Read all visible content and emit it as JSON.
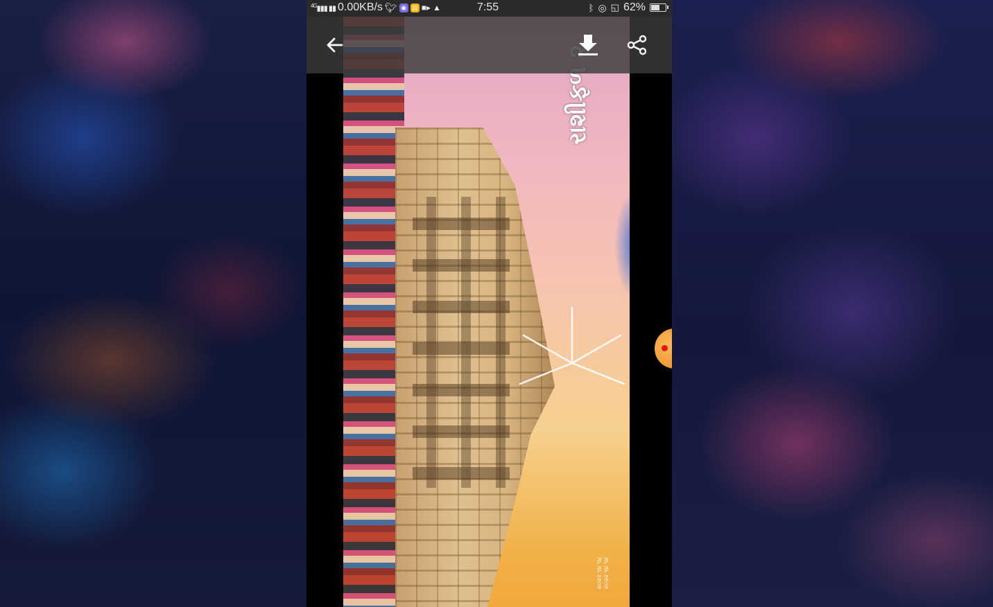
{
  "status_bar": {
    "network_type": "4G",
    "net_speed": "0.00KB/s",
    "time": "7:55",
    "battery_percent": "62%",
    "battery_level": 0.62,
    "icons": [
      "signal-icon",
      "twitter-icon",
      "app-icon",
      "notes-icon",
      "video-icon",
      "snapchat-icon",
      "bluetooth-icon",
      "eye-icon",
      "cast-icon",
      "battery-icon"
    ]
  },
  "toolbar": {
    "back_icon": "arrow-left-icon",
    "download_icon": "download-icon",
    "share_icon": "share-icon"
  },
  "image": {
    "caption_text": "રાશીફળ ૨",
    "watermark_lines": [
      "૨૦૨૨ ૧૪ ૧૪",
      "૨૦૨૨ ૧૪ ૧૪"
    ],
    "colors": {
      "sky_top": "#e0a6c8",
      "sky_bottom": "#f0a83c",
      "stone": "#d8b480"
    }
  },
  "floating_button": {
    "icon": "record-dot-icon",
    "color": "#e8891e"
  }
}
